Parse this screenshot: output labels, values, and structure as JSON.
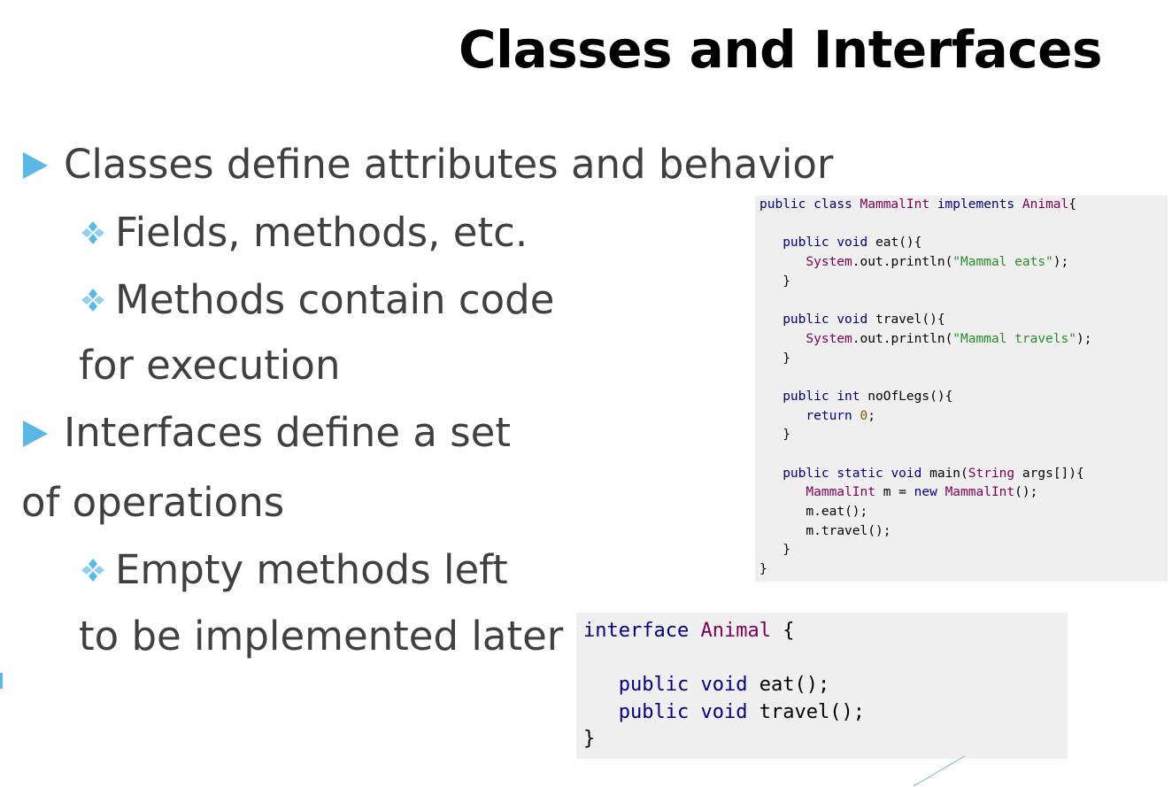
{
  "slide": {
    "title": "Classes and Interfaces",
    "bullets": {
      "b1": "Classes define attributes and behavior",
      "b1_sub1": "Fields, methods, etc.",
      "b1_sub2_line1": "Methods contain code",
      "b1_sub2_line2": "for execution",
      "b2_line1": "Interfaces define a set",
      "b2_line2": "of operations",
      "b2_sub1_line1": "Empty methods left",
      "b2_sub1_line2": "to be implemented later"
    },
    "colors": {
      "bullet_arrow": "#5bb8e6",
      "bullet_diamond": "#5bb8e6",
      "code_background": "#efefef"
    },
    "icons": {
      "main_bullet": "triangle-right-icon",
      "sub_bullet": "four-diamond-icon"
    }
  },
  "code_class": {
    "lines": [
      "public class MammalInt implements Animal{",
      "",
      "   public void eat(){",
      "      System.out.println(\"Mammal eats\");",
      "   }",
      "",
      "   public void travel(){",
      "      System.out.println(\"Mammal travels\");",
      "   }",
      "",
      "   public int noOfLegs(){",
      "      return 0;",
      "   }",
      "",
      "   public static void main(String args[]){",
      "      MammalInt m = new MammalInt();",
      "      m.eat();",
      "      m.travel();",
      "   }",
      "}"
    ]
  },
  "code_interface": {
    "lines": [
      "interface Animal {",
      "",
      "   public void eat();",
      "   public void travel();",
      "}"
    ]
  }
}
